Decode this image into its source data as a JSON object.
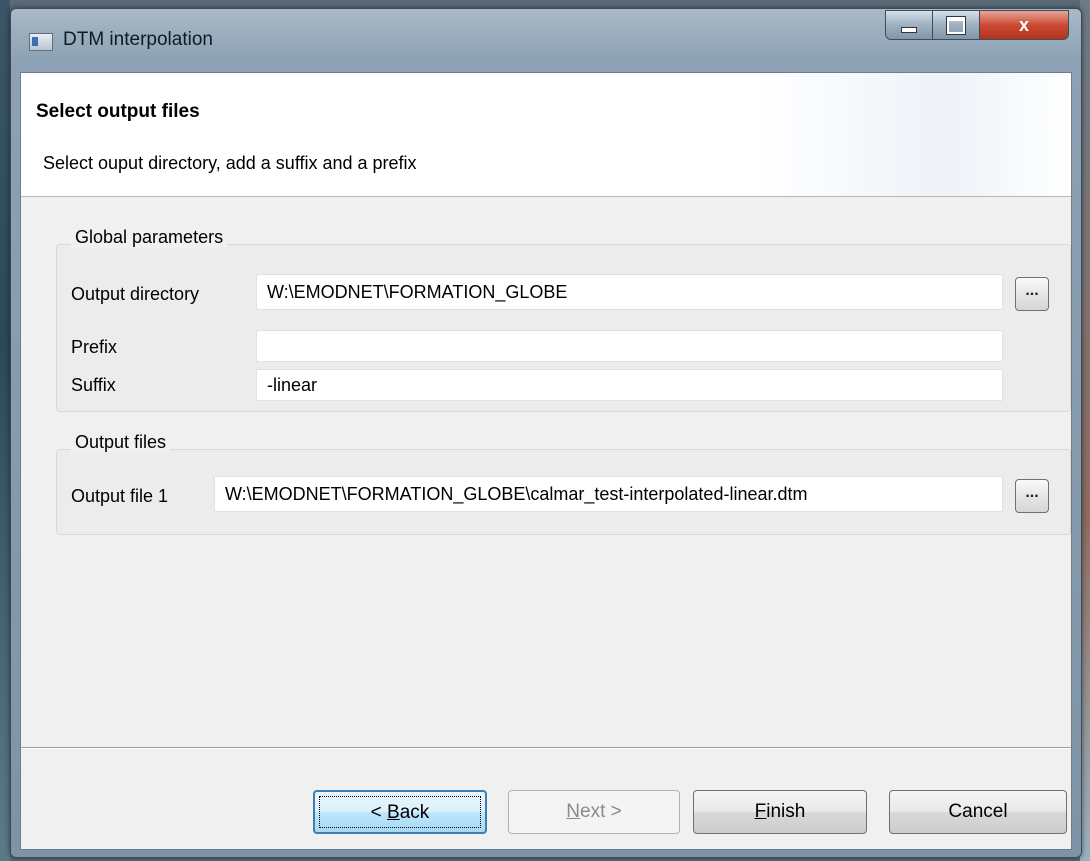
{
  "window": {
    "title": "DTM interpolation",
    "close_glyph": "x"
  },
  "header": {
    "title": "Select output files",
    "description": "Select ouput directory, add a suffix and a prefix"
  },
  "global_parameters": {
    "legend": "Global parameters",
    "output_directory_label": "Output directory",
    "output_directory_value": "W:\\EMODNET\\FORMATION_GLOBE",
    "prefix_label": "Prefix",
    "prefix_value": "",
    "suffix_label": "Suffix",
    "suffix_value": "-linear",
    "browse_label": "..."
  },
  "output_files": {
    "legend": "Output files",
    "file1_label": "Output file 1",
    "file1_value": "W:\\EMODNET\\FORMATION_GLOBE\\calmar_test-interpolated-linear.dtm",
    "browse_label": "..."
  },
  "buttons": {
    "back": {
      "pre": "< ",
      "mnemonic": "B",
      "post": "ack"
    },
    "next": {
      "pre": "",
      "mnemonic": "N",
      "post": "ext >"
    },
    "finish": {
      "pre": "",
      "mnemonic": "F",
      "post": "inish"
    },
    "cancel": "Cancel"
  },
  "icons": [
    "app-icon",
    "minimize-icon",
    "maximize-icon",
    "close-icon"
  ]
}
